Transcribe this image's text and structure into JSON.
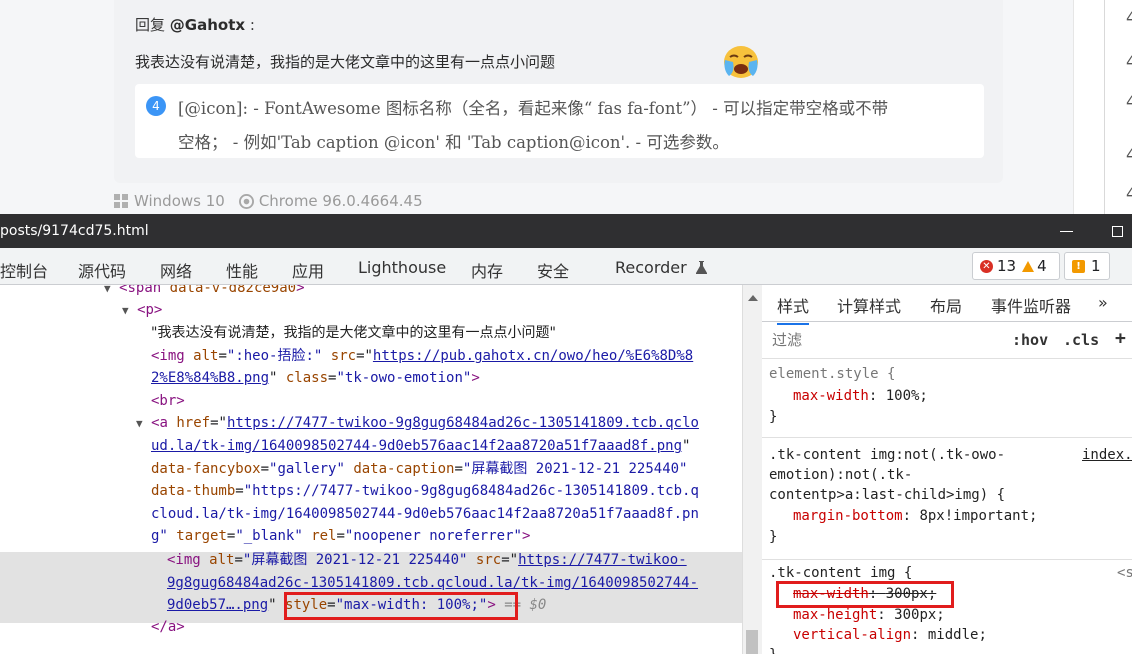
{
  "comment": {
    "reply_prefix": "回复",
    "reply_user": "@Gahotx",
    "reply_suffix": ":",
    "text": "我表达没有说清楚，我指的是大佬文章中的这里有一点点小问题",
    "emoji_icon": "crying-face-icon",
    "quote": {
      "number": "4",
      "line1": "[@icon]: - FontAwesome 图标名称（全名，看起来像“ fas fa-font”） - 可以指定带空格或不带",
      "line2": "空格； - 例如'Tab caption @icon' 和 'Tab caption@icon'. - 可选参数。"
    },
    "os": "Windows 10",
    "browser": "Chrome 96.0.4664.45"
  },
  "right_panel": {
    "items": [
      "4",
      "4",
      "4",
      "4",
      "4",
      "4"
    ]
  },
  "devtools": {
    "title_url": "posts/9174cd75.html",
    "tabs": [
      "控制台",
      "源代码",
      "网络",
      "性能",
      "应用",
      "Lighthouse",
      "内存",
      "安全",
      "Recorder"
    ],
    "issues": {
      "errors": "13",
      "warnings": "4",
      "issues": "1"
    },
    "colors": {
      "error": "#d93025",
      "warning": "#f29900",
      "accent": "#1a73e8"
    }
  },
  "elements": {
    "l0": {
      "tag_open": "<span",
      "attr": "data-v-d82ce9a0",
      "tag_close": ">"
    },
    "l1": {
      "tag": "<p>"
    },
    "l2": {
      "text": "\"我表达没有说清楚，我指的是大佬文章中的这里有一点点小问题\""
    },
    "l3": {
      "tag": "<img",
      "a1": "alt",
      "v1": "\":heo-捂脸:\"",
      "a2": "src",
      "v2_part1": "https://pub.gahotx.cn/owo/heo/%E6%8D%8",
      "v2_part2": "2%E8%84%B8.png",
      "a3": "class",
      "v3": "\"tk-owo-emotion\"",
      "close": ">"
    },
    "l4": {
      "tag": "<br>"
    },
    "l5": {
      "tag": "<a",
      "a1": "href",
      "href_part1": "https://7477-twikoo-9g8gug68484ad26c-1305141809.tcb.qcloud.la/tk-img/1640098502744-9d0eb576aac14f2aa8720a51f7aaad8f.png",
      "href_part1_a": "https://7477-twikoo-9g8gug68484ad26c-1305141809.tcb.qclo",
      "href_part1_b": "ud.la/tk-img/1640098502744-9d0eb576aac14f2aa8720a51f7aaad8f.png",
      "a2": "data-fancybox",
      "v2": "\"gallery\"",
      "a3": "data-caption",
      "v3": "\"屏幕截图 2021-12-21 225440\"",
      "a4": "data-thumb",
      "v4_a": "\"https://7477-twikoo-9g8gug68484ad26c-1305141809.tcb.q",
      "v4_b": "cloud.la/tk-img/1640098502744-9d0eb576aac14f2aa8720a51f7aaad8f.pn",
      "v4_c": "g\"",
      "a5": "target",
      "v5": "\"_blank\"",
      "a6": "rel",
      "v6": "\"noopener noreferrer\"",
      "close": ">"
    },
    "l6": {
      "tag": "<img",
      "a1": "alt",
      "v1": "\"屏幕截图 2021-12-21 225440\"",
      "a2": "src",
      "src_a": "https://7477-twikoo-",
      "src_b": "9g8gug68484ad26c-1305141809.tcb.qcloud.la/tk-img/1640098502744-",
      "src_c": "9d0eb57….png",
      "a3": "style",
      "v3": "\"max-width: 100%;\"",
      "close": ">",
      "eq": "== $0"
    },
    "l7": {
      "tag": "</a>"
    }
  },
  "styles": {
    "tabs": [
      "样式",
      "计算样式",
      "布局",
      "事件监听器",
      "»"
    ],
    "filter_placeholder": "过滤",
    "hov": ":hov",
    "cls": ".cls",
    "plus": "+",
    "rule1": {
      "selector": "element.style {",
      "prop": "max-width",
      "value": "100%;",
      "close": "}"
    },
    "rule2": {
      "sel_a": ".tk-content img:not(.tk-owo-",
      "sel_b": "emotion):not(.tk-",
      "sel_c": "contentp>a:last-child>img) {",
      "source": "index.",
      "prop": "margin-bottom",
      "value": "8px!important;",
      "close": "}"
    },
    "rule3": {
      "selector": ".tk-content img {",
      "source": "<s",
      "p1": "max-width",
      "v1": "300px;",
      "p2": "max-height",
      "v2": "300px;",
      "p3": "vertical-align",
      "v3": "middle;",
      "close": "}"
    }
  }
}
